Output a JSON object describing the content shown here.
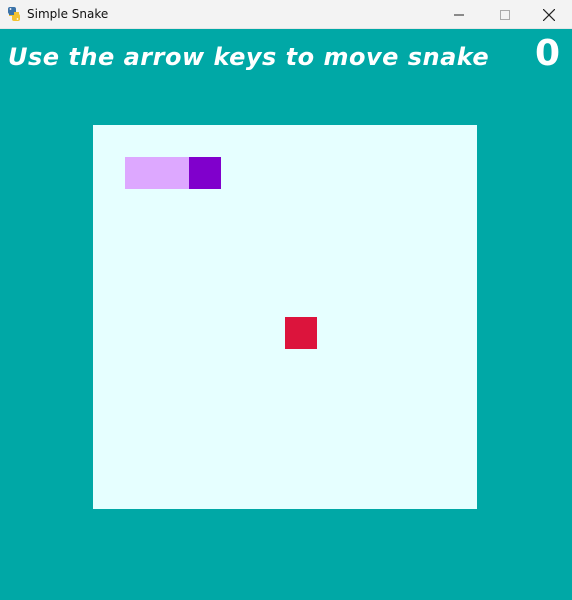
{
  "window": {
    "title": "Simple Snake",
    "app_icon": "python-icon",
    "controls": {
      "minimize_icon": "minimize-icon",
      "maximize_icon": "maximize-icon",
      "close_icon": "close-icon"
    }
  },
  "hud": {
    "instructions": "Use the arrow keys to move snake",
    "score": "0"
  },
  "game": {
    "grid_size": 12,
    "snake": {
      "head": {
        "col": 3,
        "row": 1
      },
      "body": [
        {
          "col": 1,
          "row": 1
        },
        {
          "col": 2,
          "row": 1
        }
      ]
    },
    "food": {
      "col": 6,
      "row": 6
    },
    "colors": {
      "background": "#00a8a6",
      "board": "#e6ffff",
      "snake_body": "#dda8ff",
      "snake_head": "#8000cc",
      "food": "#dc143c",
      "text": "#ffffff"
    }
  }
}
